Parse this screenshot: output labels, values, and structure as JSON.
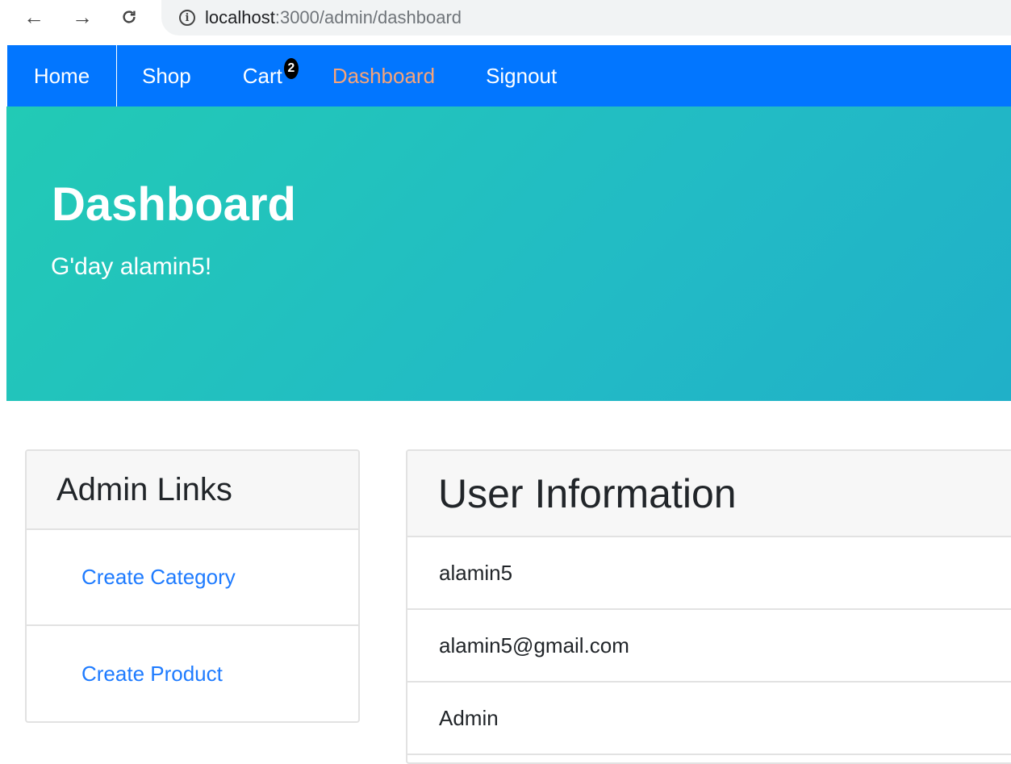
{
  "browser": {
    "back_icon": "arrow-left-icon",
    "forward_icon": "arrow-right-icon",
    "reload_icon": "reload-icon",
    "info_icon": "info-icon",
    "url_host": "localhost",
    "url_path": ":3000/admin/dashboard"
  },
  "navbar": {
    "items": [
      {
        "label": "Home"
      },
      {
        "label": "Shop"
      },
      {
        "label": "Cart"
      },
      {
        "label": "Dashboard"
      },
      {
        "label": "Signout"
      }
    ],
    "cart_badge": "2",
    "colors": {
      "background": "#0276ff",
      "active": "#f6a47a"
    }
  },
  "jumbotron": {
    "title": "Dashboard",
    "subtitle": "G'day alamin5!"
  },
  "admin_links": {
    "header": "Admin Links",
    "links": [
      {
        "label": "Create Category"
      },
      {
        "label": "Create Product"
      }
    ]
  },
  "user_info": {
    "header": "User Information",
    "rows": [
      {
        "value": "alamin5"
      },
      {
        "value": "alamin5@gmail.com"
      },
      {
        "value": "Admin"
      }
    ]
  }
}
